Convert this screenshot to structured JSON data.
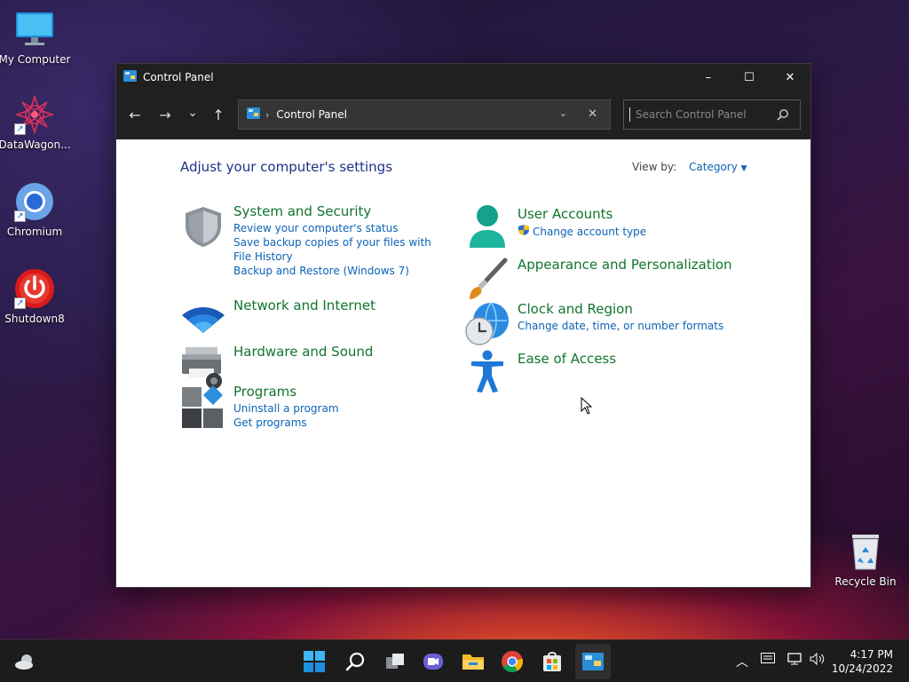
{
  "desktop": {
    "icons": [
      {
        "label": "My Computer"
      },
      {
        "label": "DataWagon..."
      },
      {
        "label": "Chromium"
      },
      {
        "label": "Shutdown8"
      },
      {
        "label": "Recycle Bin"
      }
    ]
  },
  "window": {
    "title": "Control Panel",
    "controls": {
      "minimize": "–",
      "maximize": "☐",
      "close": "✕"
    }
  },
  "navbar": {
    "back": "←",
    "forward": "→",
    "recent": "⌄",
    "up": "↑",
    "breadcrumb": "Control Panel",
    "search_placeholder": "Search Control Panel"
  },
  "content": {
    "heading": "Adjust your computer's settings",
    "view_by_label": "View by:",
    "view_by_value": "Category",
    "categories": [
      {
        "title": "System and Security",
        "links": [
          "Review your computer's status",
          "Save backup copies of your files with File History",
          "Backup and Restore (Windows 7)"
        ]
      },
      {
        "title": "Network and Internet",
        "links": []
      },
      {
        "title": "Hardware and Sound",
        "links": []
      },
      {
        "title": "Programs",
        "links": [
          "Uninstall a program",
          "Get programs"
        ]
      },
      {
        "title": "User Accounts",
        "links": [
          "Change account type"
        ]
      },
      {
        "title": "Appearance and Personalization",
        "links": []
      },
      {
        "title": "Clock and Region",
        "links": [
          "Change date, time, or number formats"
        ]
      },
      {
        "title": "Ease of Access",
        "links": []
      }
    ]
  },
  "taskbar": {
    "clock_time": "4:17 PM",
    "clock_date": "10/24/2022"
  },
  "colors": {
    "heading": "#1e3287",
    "category_title": "#12742e",
    "link": "#0b63b6",
    "titlebar": "#202020"
  }
}
